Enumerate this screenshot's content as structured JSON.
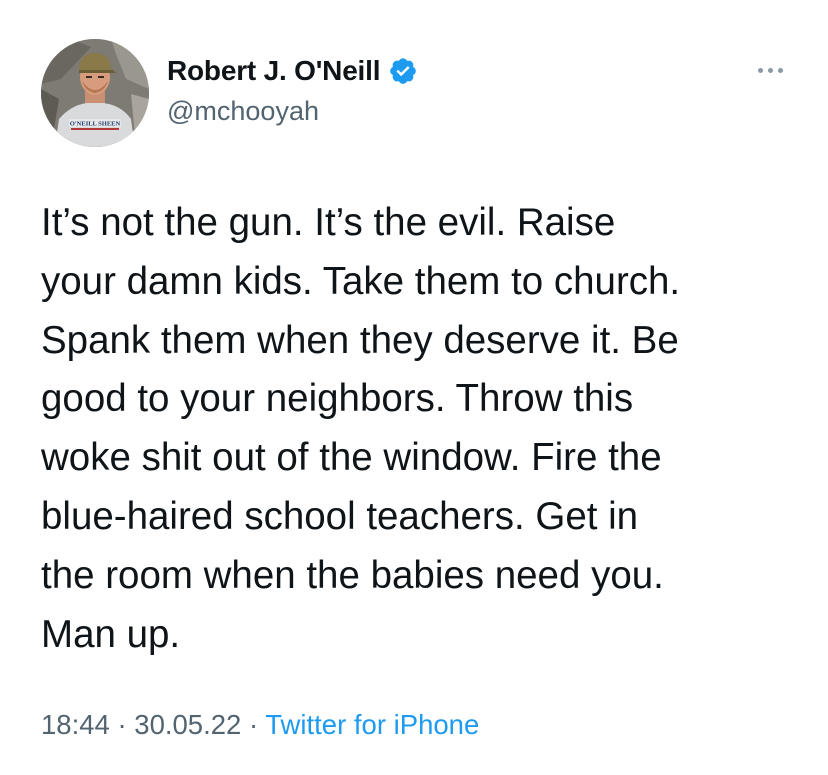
{
  "author": {
    "display_name": "Robert J. O'Neill",
    "handle": "@mchooyah",
    "verified": true,
    "avatar_shirt_text": "O'NEILL SHEEN"
  },
  "tweet": {
    "text_lines": [
      "It’s not the gun. It’s the evil. Raise",
      "your damn kids. Take them to church.",
      "Spank them when they deserve it. Be",
      "good to your neighbors. Throw this",
      "woke shit out of the window. Fire the",
      "blue-haired school teachers. Get in",
      "the room when the babies need you.",
      "Man up."
    ]
  },
  "meta": {
    "time": "18:44",
    "separator": " · ",
    "date": "30.05.22",
    "source": "Twitter for iPhone"
  },
  "icons": {
    "verified": "verified-badge-icon",
    "more": "more-options-icon"
  },
  "colors": {
    "verified_blue": "#1d9bf0",
    "secondary_text": "#536471",
    "primary_text": "#0f1419",
    "link": "#1d9bf0"
  }
}
